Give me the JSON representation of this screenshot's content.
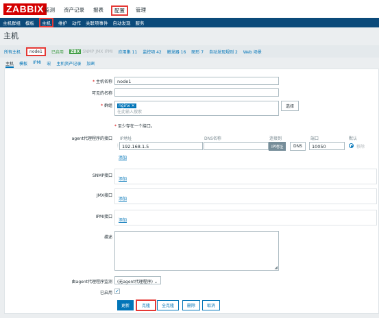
{
  "logo": "ZABBIX",
  "top_menu": [
    "监测",
    "资产记录",
    "报表",
    "配置",
    "管理"
  ],
  "sub_menu": [
    "主机群组",
    "模板",
    "主机",
    "维护",
    "动作",
    "关联项事件",
    "自动发现",
    "服务"
  ],
  "page_title": "主机",
  "filter": {
    "all_hosts": "所有主机",
    "host": "node1",
    "enabled": "已启用",
    "zbx": "ZBX",
    "snmp": "SNMP",
    "jmx": "JMX",
    "ipmi": "IPMI",
    "apps": "应用集 11",
    "items": "监控项 42",
    "triggers": "触发器 16",
    "graphs": "图形 7",
    "discovery": "自动发现规则 2",
    "web": "Web 场景"
  },
  "tabs": [
    "主机",
    "模板",
    "IPMI",
    "宏",
    "主机资产记录",
    "加密"
  ],
  "form": {
    "hostname_label": "主机名称",
    "hostname_value": "node1",
    "visible_name_label": "可见的名称",
    "groups_label": "群组",
    "group_tag": "nginx",
    "group_tag_remove": "✕",
    "groups_placeholder": "在此输入搜索",
    "select_button": "选择",
    "interface_required": "至少存在一个接口。",
    "agent_label": "agent代理程序的接口",
    "col_ip": "IP地址",
    "col_dns": "DNS名称",
    "col_connect": "连接到",
    "col_port": "端口",
    "col_default": "默认",
    "agent_ip": "192.168.1.5",
    "agent_dns": "",
    "connect_ip": "IP地址",
    "connect_dns": "DNS",
    "agent_port": "10050",
    "remove_link": "移除",
    "add_link": "添加",
    "snmp_label": "SNMP接口",
    "jmx_label": "JMX接口",
    "ipmi_label": "IPMI接口",
    "description_label": "描述",
    "monitored_by_label": "由agent代理程序监测",
    "monitored_by_value": "(无agent代理程序)",
    "enabled_label": "已启用",
    "buttons": {
      "update": "更新",
      "clone": "克隆",
      "full_clone": "全克隆",
      "delete": "删除",
      "cancel": "取消"
    }
  }
}
